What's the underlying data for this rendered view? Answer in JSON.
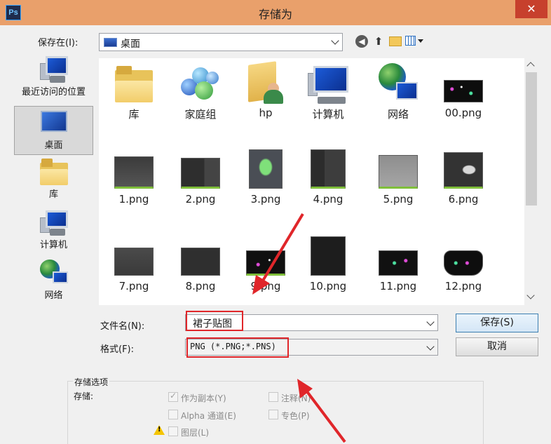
{
  "window": {
    "title": "存储为",
    "app_icon_text": "Ps",
    "close_glyph": "✕"
  },
  "toolbar": {
    "save_in_label": "保存在(I):",
    "save_in_value": "桌面"
  },
  "places": [
    {
      "label": "最近访问的位置",
      "icon": "recent-places-icon"
    },
    {
      "label": "桌面",
      "icon": "desktop-icon",
      "selected": true
    },
    {
      "label": "库",
      "icon": "library-icon"
    },
    {
      "label": "计算机",
      "icon": "computer-icon"
    },
    {
      "label": "网络",
      "icon": "network-icon"
    }
  ],
  "files": [
    {
      "label": "库",
      "icon": "library-folder-icon"
    },
    {
      "label": "家庭组",
      "icon": "homegroup-icon"
    },
    {
      "label": "hp",
      "icon": "user-folder-icon"
    },
    {
      "label": "计算机",
      "icon": "computer-icon"
    },
    {
      "label": "网络",
      "icon": "network-icon"
    },
    {
      "label": "00.png",
      "icon": "image-thumbnail"
    },
    {
      "label": "1.png",
      "icon": "image-thumbnail"
    },
    {
      "label": "2.png",
      "icon": "image-thumbnail"
    },
    {
      "label": "3.png",
      "icon": "image-thumbnail"
    },
    {
      "label": "4.png",
      "icon": "image-thumbnail"
    },
    {
      "label": "5.png",
      "icon": "image-thumbnail"
    },
    {
      "label": "6.png",
      "icon": "image-thumbnail"
    },
    {
      "label": "7.png",
      "icon": "image-thumbnail"
    },
    {
      "label": "8.png",
      "icon": "image-thumbnail"
    },
    {
      "label": "9.png",
      "icon": "image-thumbnail"
    },
    {
      "label": "10.png",
      "icon": "image-thumbnail"
    },
    {
      "label": "11.png",
      "icon": "image-thumbnail"
    },
    {
      "label": "12.png",
      "icon": "image-thumbnail"
    }
  ],
  "form": {
    "filename_label": "文件名(N):",
    "filename_value": "裙子贴图",
    "format_label": "格式(F):",
    "format_value": "PNG (*.PNG;*.PNS)",
    "save_button": "保存(S)",
    "cancel_button": "取消"
  },
  "options": {
    "group_title": "存储选项",
    "store_label": "存储:",
    "as_copy": "作为副本(Y)",
    "notes": "注释(N)",
    "alpha": "Alpha 通道(E)",
    "spot": "专色(P)",
    "layers": "图层(L)",
    "as_copy_checked": true
  },
  "colors": {
    "titlebar": "#e9a06b",
    "close": "#c7402d",
    "highlight_box": "#e0262a"
  }
}
